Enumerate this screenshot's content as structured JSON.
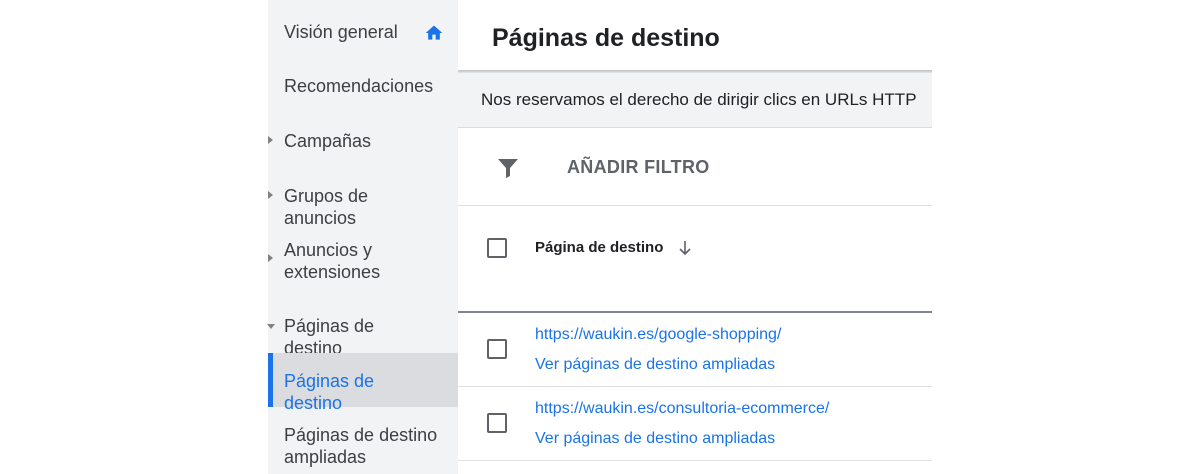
{
  "sidebar": {
    "items": [
      {
        "label": "Visión general"
      },
      {
        "label": "Recomendaciones"
      },
      {
        "label": "Campañas"
      },
      {
        "label": "Grupos de anuncios"
      },
      {
        "label": "Anuncios y extensiones"
      },
      {
        "label": "Páginas de destino"
      },
      {
        "label": "Páginas de destino"
      },
      {
        "label": "Páginas de destino ampliadas"
      }
    ],
    "active_color": "#1a73e8"
  },
  "main": {
    "title": "Páginas de destino",
    "banner_text": "Nos reservamos el derecho de dirigir clics en URLs HTTP",
    "filter_label": "AÑADIR FILTRO",
    "table": {
      "column_header": "Página de destino",
      "rows": [
        {
          "url": "https://waukin.es/google-shopping/",
          "expand_label": "Ver páginas de destino ampliadas"
        },
        {
          "url": "https://waukin.es/consultoria-ecommerce/",
          "expand_label": "Ver páginas de destino ampliadas"
        }
      ]
    }
  },
  "icons": {
    "home": "home-icon",
    "filter": "filter-icon",
    "sort": "arrow-down-icon",
    "expand_collapsed": "caret-right-icon",
    "expand_open": "caret-down-icon"
  }
}
